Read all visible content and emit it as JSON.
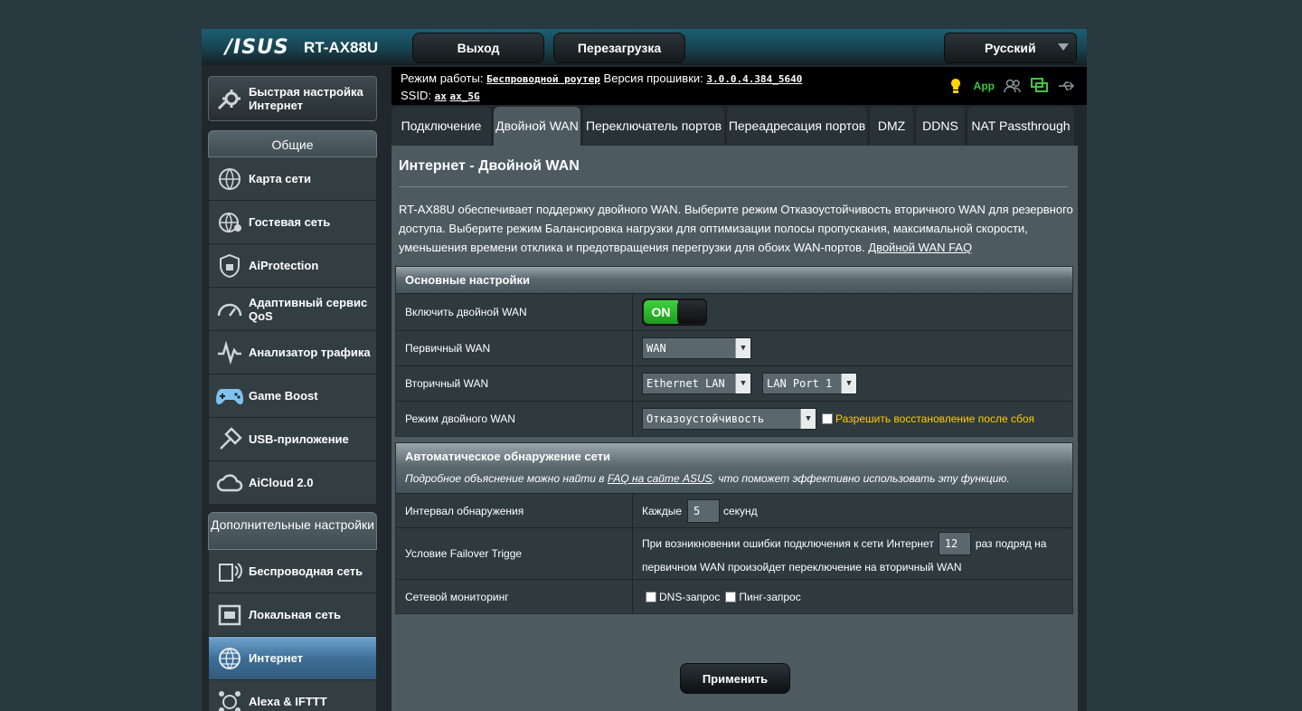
{
  "header": {
    "logo": "/ISUS",
    "model": "RT-AX88U",
    "logout_label": "Выход",
    "reboot_label": "Перезагрузка",
    "language": "Русский"
  },
  "infobar": {
    "mode_prefix": "Режим работы:",
    "mode_value": "Беспроводной роутер",
    "fw_prefix": "Версия прошивки:",
    "fw_value": "3.0.0.4.384_5640",
    "ssid_prefix": "SSID:",
    "ssid_1": "ax",
    "ssid_2": "ax_5G",
    "app_label": "App"
  },
  "sidebar": {
    "quick_setup": "Быстрая настройка Интернет",
    "general_title": "Общие",
    "general_items": [
      {
        "label": "Карта сети",
        "icon": "network-map-icon"
      },
      {
        "label": "Гостевая сеть",
        "icon": "guest-network-icon"
      },
      {
        "label": "AiProtection",
        "icon": "shield-icon"
      },
      {
        "label": "Адаптивный сервис QoS",
        "icon": "gauge-icon"
      },
      {
        "label": "Анализатор трафика",
        "icon": "traffic-analyzer-icon"
      },
      {
        "label": "Game Boost",
        "icon": "gamepad-icon"
      },
      {
        "label": "USB-приложение",
        "icon": "usb-icon"
      },
      {
        "label": "AiCloud 2.0",
        "icon": "cloud-icon"
      }
    ],
    "advanced_title": "Дополнительные настройки",
    "advanced_items": [
      {
        "label": "Беспроводная сеть",
        "icon": "wireless-icon"
      },
      {
        "label": "Локальная сеть",
        "icon": "lan-icon"
      },
      {
        "label": "Интернет",
        "icon": "globe-icon"
      },
      {
        "label": "Alexa & IFTTT",
        "icon": "alexa-icon"
      }
    ]
  },
  "tabs": [
    "Подключение",
    "Двойной WAN",
    "Переключатель портов",
    "Переадресация портов",
    "DMZ",
    "DDNS",
    "NAT Passthrough"
  ],
  "page": {
    "title": "Интернет - Двойной WAN",
    "description": "RT-AX88U обеспечивает поддержку двойного WAN. Выберите режим Отказоустойчивость вторичного WAN для резервного доступа. Выберите режим Балансировка нагрузки для оптимизации полосы пропускания, максимальной скорости, уменьшения времени отклика и предотвращения перегрузки для обоих WAN-портов.",
    "faq_link": "Двойной WAN FAQ"
  },
  "basic": {
    "title": "Основные настройки",
    "enable_label": "Включить двойной WAN",
    "toggle_on": "ON",
    "primary_label": "Первичный WAN",
    "primary_value": "WAN",
    "secondary_label": "Вторичный WAN",
    "secondary_value": "Ethernet LAN",
    "secondary_port": "LAN Port 1",
    "mode_label": "Режим двойного WAN",
    "mode_value": "Отказоустойчивость",
    "failback_label": "Разрешить восстановление после сбоя"
  },
  "detect": {
    "title": "Автоматическое обнаружение сети",
    "note_pre": "Подробное объяснение можно найти в",
    "note_link": "FAQ на сайте ASUS",
    "note_post": ", что поможет эффективно использовать эту функцию.",
    "interval_label": "Интервал обнаружения",
    "interval_pre": "Каждые",
    "interval_value": "5",
    "interval_post": "секунд",
    "trigger_label": "Условие Failover Trigge",
    "trigger_pre": "При возникновении ошибки подключения к сети Интернет",
    "trigger_value": "12",
    "trigger_post": "раз подряд на",
    "trigger_line2": "первичном WAN произойдет переключение на вторичный WAN",
    "monitor_label": "Сетевой мониторинг",
    "dns_label": "DNS-запрос",
    "ping_label": "Пинг-запрос"
  },
  "apply_label": "Применить",
  "colors": {
    "accent_green": "#3ec73e",
    "active_blue": "#3e6f98",
    "warning_yellow": "#ffcc00"
  }
}
